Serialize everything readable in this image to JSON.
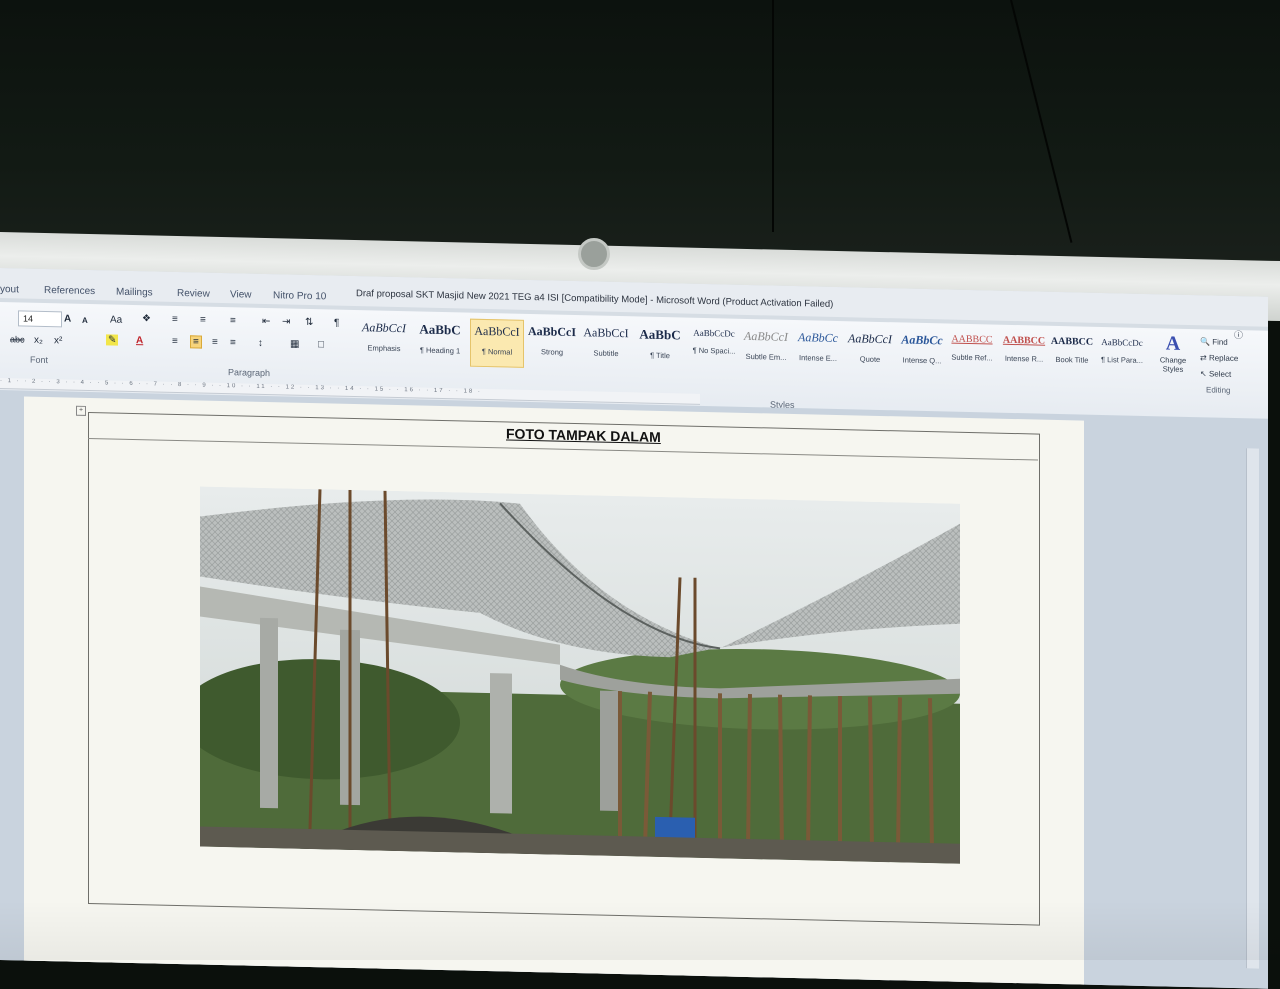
{
  "window": {
    "title": "Draf proposal SKT Masjid New 2021 TEG a4 ISI [Compatibility Mode]  -  Microsoft Word (Product Activation Failed)"
  },
  "tabs": [
    "yout",
    "References",
    "Mailings",
    "Review",
    "View",
    "Nitro Pro 10"
  ],
  "font_group": {
    "font_size": "14",
    "label": "Font",
    "grow_label": "A",
    "case_label": "Aa",
    "strike_label": "abc",
    "sub_label": "x₂",
    "sup_label": "x²"
  },
  "paragraph_group": {
    "label": "Paragraph"
  },
  "styles_group": {
    "label": "Styles",
    "items": [
      {
        "sample": "AaBbCcI",
        "name": "Emphasis"
      },
      {
        "sample": "AaBbC",
        "name": "¶ Heading 1"
      },
      {
        "sample": "AaBbCcI",
        "name": "¶ Normal"
      },
      {
        "sample": "AaBbCcI",
        "name": "Strong"
      },
      {
        "sample": "AaBbCcI",
        "name": "Subtitle"
      },
      {
        "sample": "AaBbC",
        "name": "¶ Title"
      },
      {
        "sample": "AaBbCcDc",
        "name": "¶ No Spaci..."
      },
      {
        "sample": "AaBbCcI",
        "name": "Subtle Em..."
      },
      {
        "sample": "AaBbCc",
        "name": "Intense E..."
      },
      {
        "sample": "AaBbCcI",
        "name": "Quote"
      },
      {
        "sample": "AaBbCc",
        "name": "Intense Q..."
      },
      {
        "sample": "AABBCC",
        "name": "Subtle Ref..."
      },
      {
        "sample": "AABBCC",
        "name": "Intense R..."
      },
      {
        "sample": "AABBCC",
        "name": "Book Title"
      },
      {
        "sample": "AaBbCcDc",
        "name": "¶ List Para..."
      }
    ]
  },
  "change_styles": {
    "line1": "Change",
    "line2": "Styles"
  },
  "editing_group": {
    "find": "Find",
    "replace": "Replace",
    "select": "Select",
    "label": "Editing"
  },
  "ruler": "· 1 · · 2 · · 3 · · 4 · · 5 · · 6 · · 7 · · 8 · · 9 · · 10 · · 11 · · 12 · · 13 · · 14 · · 15 · · 16 · · 17 · · 18 ·",
  "document": {
    "heading": "FOTO TAMPAK DALAM"
  },
  "colors": {
    "accent": "#2b579a",
    "active_style": "#fbe9b0",
    "page": "#f6f6f0"
  }
}
